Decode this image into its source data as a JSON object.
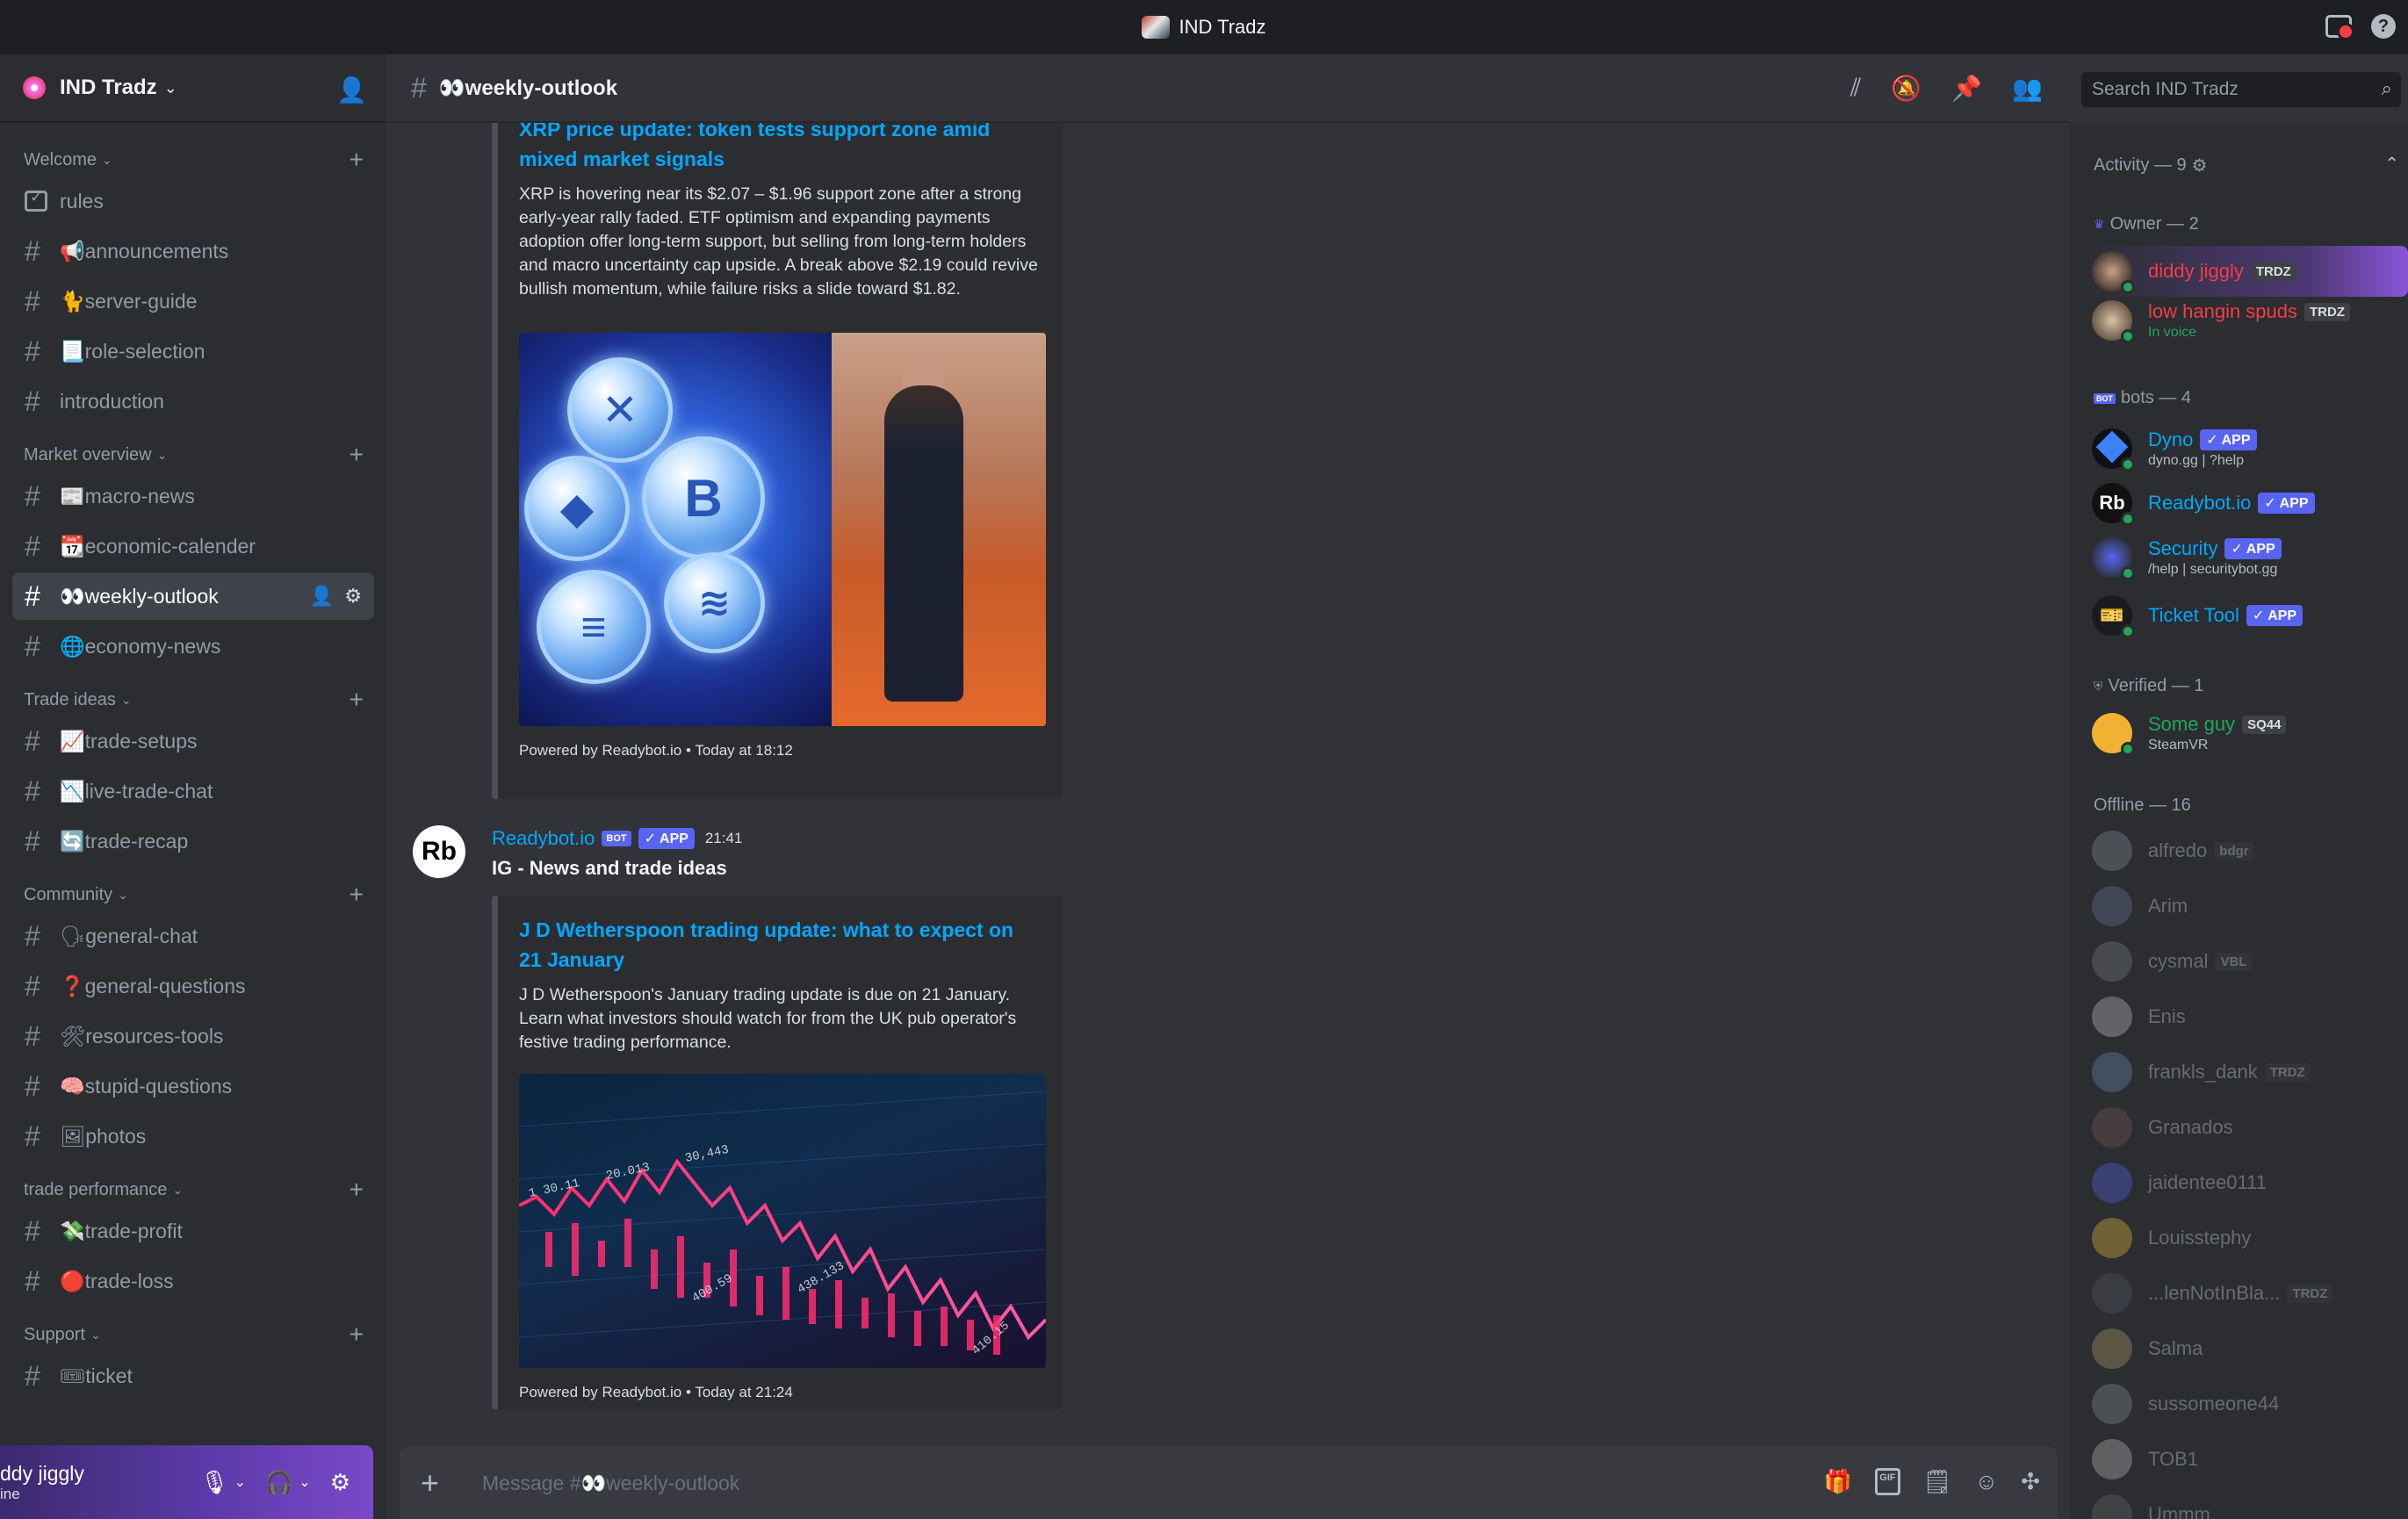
{
  "titlebar": {
    "title": "IND Tradz"
  },
  "server": {
    "name": "IND Tradz"
  },
  "sidebar": {
    "categories": [
      {
        "name": "Welcome",
        "channels": [
          "rules",
          "📢announcements",
          "🐈server-guide",
          "📃role-selection",
          "introduction"
        ]
      },
      {
        "name": "Market overview",
        "channels": [
          "📰macro-news",
          "📆economic-calender",
          "👀weekly-outlook",
          "🌐economy-news"
        ]
      },
      {
        "name": "Trade ideas",
        "channels": [
          "📈trade-setups",
          "📉live-trade-chat",
          "🔄trade-recap"
        ]
      },
      {
        "name": "Community",
        "channels": [
          "🗣general-chat",
          "❓general-questions",
          "🛠resources-tools",
          "🧠stupid-questions",
          "🖼photos"
        ]
      },
      {
        "name": "trade performance",
        "channels": [
          "💸trade-profit",
          "🔴trade-loss"
        ]
      },
      {
        "name": "Support",
        "channels": [
          "🎟ticket"
        ]
      }
    ],
    "active_channel": "👀weekly-outlook"
  },
  "user_panel": {
    "name": "ddy jiggly",
    "status": "ine"
  },
  "header": {
    "channel": "👀weekly-outlook",
    "search_placeholder": "Search IND Tradz"
  },
  "messages": {
    "embed1": {
      "title": "XRP price update: token tests support zone amid mixed market signals",
      "desc": "XRP is hovering near its $2.07 – $1.96 support zone after a strong early-year rally faded. ETF optimism and expanding payments adoption offer long-term support, but selling from long-term holders and macro uncertainty cap upside. A break above $2.19 could revive bullish momentum, while failure risks a slide toward $1.82.",
      "footer": "Powered by Readybot.io • Today at 18:12"
    },
    "msg2": {
      "author": "Readybot.io",
      "bot_tag": "BOT",
      "app_tag": "✓ APP",
      "time": "21:41",
      "text": "IG - News and trade ideas",
      "avatar_text": "Rb"
    },
    "embed2": {
      "title": "J D Wetherspoon trading update: what to expect on 21 January",
      "desc": "J D Wetherspoon's January trading update is due on 21 January. Learn what investors should watch for from the UK pub operator's festive trading performance.",
      "footer": "Powered by Readybot.io • Today at 21:24"
    }
  },
  "composer": {
    "placeholder": "Message #👀weekly-outlook"
  },
  "members": {
    "activity_label": "Activity — 9",
    "groups": {
      "owner": "Owner — 2",
      "bots": "bots — 4",
      "verified": "Verified — 1",
      "offline": "Offline — 16"
    },
    "owner": [
      {
        "name": "diddy jiggly",
        "tag": "TRDZ",
        "color": "#f23f43"
      },
      {
        "name": "low hangin spuds",
        "tag": "TRDZ",
        "sub": "In voice",
        "color": "#f23f43"
      }
    ],
    "bots": [
      {
        "name": "Dyno",
        "badge": "✓ APP",
        "sub": "dyno.gg | ?help"
      },
      {
        "name": "Readybot.io",
        "badge": "✓ APP",
        "avatar_text": "Rb"
      },
      {
        "name": "Security",
        "badge": "✓ APP",
        "sub": "/help | securitybot.gg"
      },
      {
        "name": "Ticket Tool",
        "badge": "✓ APP"
      }
    ],
    "verified": [
      {
        "name": "Some guy",
        "tag": "SQ44",
        "sub": "SteamVR",
        "color": "#23a55a"
      }
    ],
    "offline": [
      {
        "name": "alfredo",
        "tag": "bdgr"
      },
      {
        "name": "Arim"
      },
      {
        "name": "cysmal",
        "tag": "VBL"
      },
      {
        "name": "Enis"
      },
      {
        "name": "frankls_dank",
        "tag": "TRDZ"
      },
      {
        "name": "Granados"
      },
      {
        "name": "jaidentee0111"
      },
      {
        "name": "Louisstephy"
      },
      {
        "name": "...lenNotInBla...",
        "tag": "TRDZ"
      },
      {
        "name": "Salma"
      },
      {
        "name": "sussomeone44"
      },
      {
        "name": "TOB1"
      },
      {
        "name": "Ummm"
      }
    ]
  },
  "colors": {
    "accent": "#5865f2",
    "link": "#00a8fc",
    "online": "#23a55a",
    "bg": "#313338",
    "sidebar": "#2b2d31"
  }
}
